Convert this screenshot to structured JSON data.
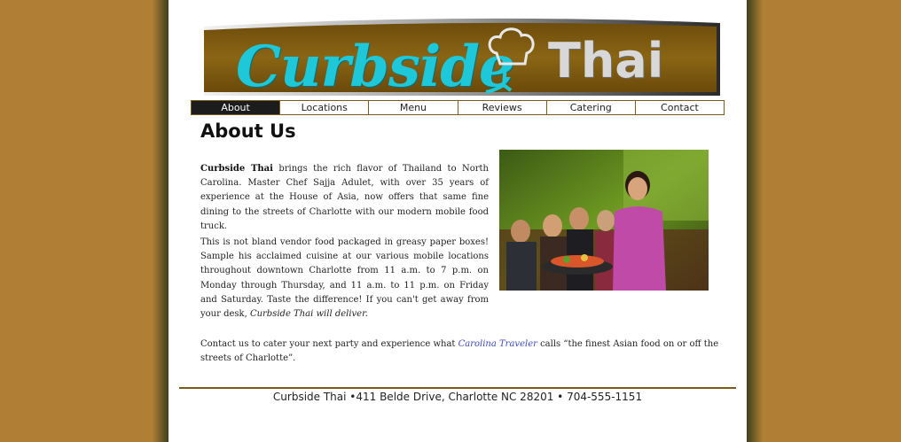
{
  "banner": {
    "brand_part1": "Curbside",
    "brand_part2": "Thai",
    "colors": {
      "bar": "#7d5a12",
      "script": "#1ec8d8",
      "thai": "#d8d8d8"
    }
  },
  "nav": {
    "items": [
      {
        "label": "About",
        "active": true
      },
      {
        "label": "Locations"
      },
      {
        "label": "Menu"
      },
      {
        "label": "Reviews"
      },
      {
        "label": "Catering"
      },
      {
        "label": "Contact"
      }
    ]
  },
  "main": {
    "title": "About Us",
    "p1_bold": "Curbside Thai",
    "p1_rest": " brings the rich flavor of Thailand to North Carolina. Master Chef Sajja Adulet, with over 35 years of experience at the House of Asia, now offers that same fine dining to the streets of Charlotte with our modern mobile food truck.",
    "p2_main": "This is not bland vendor food packaged in greasy paper boxes! Sample his acclaimed cuisine at our various mobile locations throughout downtown Charlotte from 11 a.m. to 7 p.m. on Monday through Thursday, and 11 a.m. to 11 p.m. on Friday and Saturday. Taste the difference! If you can't get away from your desk, ",
    "p2_italic": "Curbside Thai will deliver.",
    "p3_pre": "Contact us to cater your next party and experience what ",
    "p3_link": "Carolina Traveler",
    "p3_post": " calls “the finest Asian food on or off the streets of Charlotte”."
  },
  "footer": {
    "text": "Curbside Thai •411 Belde Drive, Charlotte NC   28201 • 704-555-1151"
  }
}
